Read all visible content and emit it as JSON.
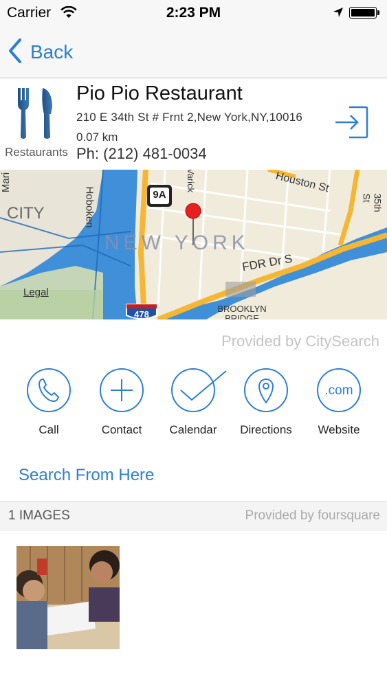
{
  "status_bar": {
    "carrier": "Carrier",
    "time": "2:23 PM"
  },
  "nav": {
    "back_label": "Back"
  },
  "place": {
    "name": "Pio Pio Restaurant",
    "address": "210 E 34th St # Frnt 2,New York,NY,10016",
    "distance": "0.07 km",
    "phone": "Ph: (212) 481-0034",
    "category": "Restaurants"
  },
  "map": {
    "labels": {
      "city": "CITY",
      "new_york": "NEW YORK",
      "fdr": "FDR Dr S",
      "houston": "Houston St",
      "brooklyn_bridge": "BROOKLYN BRIDGE",
      "hoboken": "Hoboken",
      "mari": "Mari",
      "varick": "Varick",
      "st35": "35th St",
      "route_9a": "9A",
      "route_478": "478"
    },
    "legal": "Legal"
  },
  "provided_by_citysearch": "Provided by CitySearch",
  "actions": [
    {
      "label": "Call",
      "icon": "phone-icon"
    },
    {
      "label": "Contact",
      "icon": "plus-icon"
    },
    {
      "label": "Calendar",
      "icon": "checkmark-icon"
    },
    {
      "label": "Directions",
      "icon": "map-pin-icon"
    },
    {
      "label": "Website",
      "icon": "dotcom-icon"
    }
  ],
  "search_from_here": "Search From Here",
  "images": {
    "count_label": "1 IMAGES",
    "provided_by": "Provided by foursquare"
  },
  "colors": {
    "accent": "#2a7fd6",
    "water": "#3f8fd9",
    "land": "#f1ebdc",
    "highway": "#f5b733"
  }
}
